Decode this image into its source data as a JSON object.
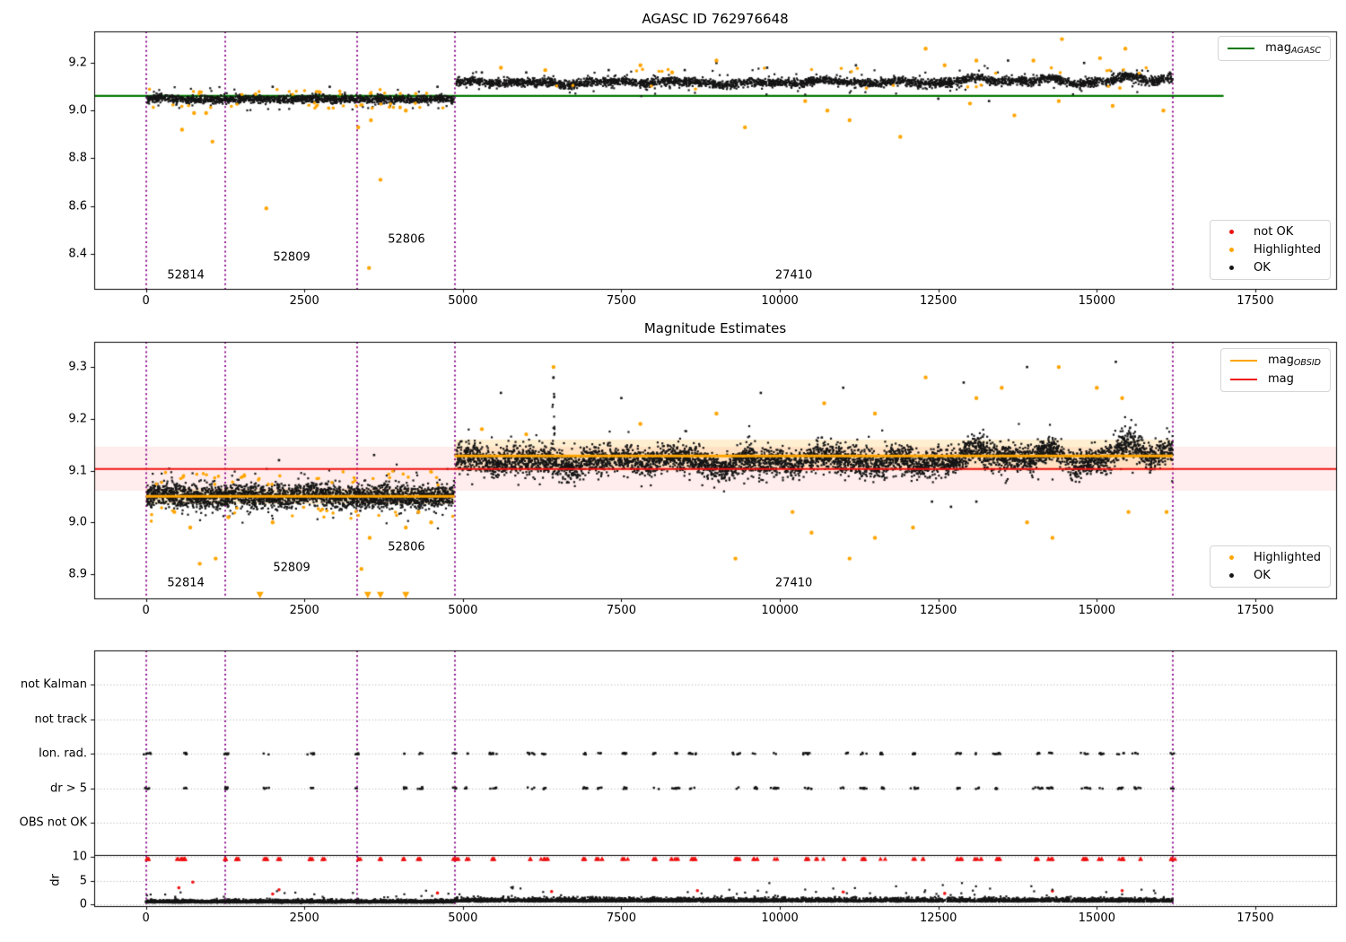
{
  "figure": {
    "title_top": "AGASC ID 762976648",
    "title_mid": "Magnitude Estimates"
  },
  "colors": {
    "green": "#007800",
    "red": "#ee1111",
    "orange": "#ffa500",
    "purple": "#880088",
    "black": "#151515",
    "band_pink": "rgba(255,40,40,0.09)",
    "band_orange": "rgba(255,165,0,0.18)",
    "grid": "#aaaaaa"
  },
  "legends": {
    "top_line": {
      "main": "mag",
      "sub": "AGASC",
      "color": "#007800"
    },
    "top_markers": [
      {
        "label": "not OK",
        "color": "#ee1111"
      },
      {
        "label": "Highlighted",
        "color": "#ffa500"
      },
      {
        "label": "OK",
        "color": "#151515"
      }
    ],
    "mid_lines": [
      {
        "main": "mag",
        "sub": "OBSID",
        "color": "#ffa500"
      },
      {
        "main": "mag",
        "sub": "",
        "color": "#ee1111"
      }
    ],
    "mid_markers": [
      {
        "label": "Highlighted",
        "color": "#ffa500"
      },
      {
        "label": "OK",
        "color": "#151515"
      }
    ]
  },
  "chart_data": [
    {
      "id": "agasc-mag-plot",
      "type": "scatter",
      "title": "AGASC ID 762976648",
      "xlim": [
        -815,
        18775
      ],
      "ylim": [
        8.25,
        9.33
      ],
      "xticks": [
        "0",
        "2500",
        "5000",
        "7500",
        "10000",
        "12500",
        "15000",
        "17500"
      ],
      "xtick_values": [
        0,
        2500,
        5000,
        7500,
        10000,
        12500,
        15000,
        17500
      ],
      "yticks": [
        "8.4",
        "8.6",
        "8.8",
        "9.0",
        "9.2"
      ],
      "ytick_values": [
        8.4,
        8.6,
        8.8,
        9.0,
        9.2
      ],
      "mag_agasc_line": {
        "y": 9.062,
        "x0": -815,
        "x1": 17000
      },
      "obsid_boundaries": [
        0,
        1250,
        3330,
        4870,
        16200
      ],
      "obsid_labels": [
        {
          "text": "52814",
          "x": 630,
          "y": 8.31
        },
        {
          "text": "52809",
          "x": 2300,
          "y": 8.385
        },
        {
          "text": "52806",
          "x": 4110,
          "y": 8.46
        },
        {
          "text": "27410",
          "x": 10220,
          "y": 8.31
        }
      ],
      "series_ok_segments": [
        {
          "x0": 20,
          "x1": 4860,
          "n": 1500,
          "mean": 9.048,
          "sd": 0.008,
          "wobble": 0.003,
          "trend": 0
        },
        {
          "x0": 4890,
          "x1": 16200,
          "n": 3300,
          "mean": 9.118,
          "sd": 0.009,
          "wobble": 0.01,
          "trend": 0.013
        }
      ],
      "highlighted_points": [
        [
          570,
          8.92
        ],
        [
          760,
          8.99
        ],
        [
          950,
          8.99
        ],
        [
          1050,
          8.87
        ],
        [
          1900,
          8.59
        ],
        [
          3350,
          8.93
        ],
        [
          3520,
          8.34
        ],
        [
          3550,
          8.96
        ],
        [
          3700,
          8.71
        ],
        [
          4100,
          9.0
        ],
        [
          9450,
          8.93
        ],
        [
          10400,
          9.04
        ],
        [
          10750,
          9.0
        ],
        [
          11100,
          8.96
        ],
        [
          11900,
          8.89
        ],
        [
          13000,
          9.03
        ],
        [
          13700,
          8.98
        ],
        [
          14400,
          9.04
        ],
        [
          15250,
          9.02
        ],
        [
          16050,
          9.0
        ],
        [
          12300,
          9.26
        ],
        [
          13100,
          9.21
        ],
        [
          14450,
          9.3
        ],
        [
          15450,
          9.26
        ],
        [
          12600,
          9.19
        ],
        [
          14000,
          9.21
        ],
        [
          15050,
          9.22
        ],
        [
          5600,
          9.18
        ],
        [
          7800,
          9.19
        ],
        [
          9000,
          9.21
        ],
        [
          6300,
          9.17
        ],
        [
          8300,
          9.16
        ]
      ],
      "black_outliers": [
        [
          2000,
          9.1
        ],
        [
          2900,
          9.1
        ],
        [
          4600,
          9.1
        ],
        [
          5300,
          9.16
        ],
        [
          6000,
          9.16
        ],
        [
          7300,
          9.17
        ],
        [
          8500,
          9.17
        ],
        [
          9000,
          9.2
        ],
        [
          9800,
          9.18
        ],
        [
          11200,
          9.19
        ],
        [
          13600,
          9.21
        ],
        [
          14800,
          9.2
        ],
        [
          12500,
          9.05
        ],
        [
          13300,
          9.04
        ]
      ]
    },
    {
      "id": "magnitude-estimates-plot",
      "type": "scatter",
      "title": "Magnitude Estimates",
      "xlim": [
        -815,
        18775
      ],
      "ylim": [
        8.855,
        9.35
      ],
      "xticks": [
        "0",
        "2500",
        "5000",
        "7500",
        "10000",
        "12500",
        "15000",
        "17500"
      ],
      "xtick_values": [
        0,
        2500,
        5000,
        7500,
        10000,
        12500,
        15000,
        17500
      ],
      "yticks": [
        "8.9",
        "9.0",
        "9.1",
        "9.2",
        "9.3"
      ],
      "ytick_values": [
        8.9,
        9.0,
        9.1,
        9.2,
        9.3
      ],
      "mag_line": {
        "y": 9.103
      },
      "mag_err_band": [
        9.061,
        9.146
      ],
      "obsid_mag_segments": [
        {
          "x0": 0,
          "x1": 4870,
          "mag": 9.05,
          "band": [
            9.035,
            9.065
          ]
        },
        {
          "x0": 4870,
          "x1": 16200,
          "mag": 9.128,
          "band": [
            9.1,
            9.16
          ]
        }
      ],
      "obsid_boundaries": [
        0,
        1250,
        3330,
        4870,
        16200
      ],
      "obsid_labels": [
        {
          "text": "52814",
          "x": 630,
          "y": 8.8825
        },
        {
          "text": "52809",
          "x": 2300,
          "y": 8.912
        },
        {
          "text": "52806",
          "x": 4110,
          "y": 8.952
        },
        {
          "text": "27410",
          "x": 10220,
          "y": 8.8825
        }
      ],
      "series_ok_segments": [
        {
          "x0": 20,
          "x1": 4860,
          "n": 2600,
          "mean": 9.05,
          "sd": 0.011,
          "wobble": 0.004,
          "trend": 0
        },
        {
          "x0": 4890,
          "x1": 16200,
          "n": 5200,
          "mean": 9.118,
          "sd": 0.013,
          "wobble": 0.013,
          "trend": 0.016
        }
      ],
      "black_streak": {
        "x": 6430,
        "y0": 9.14,
        "y1": 9.28,
        "n": 16
      },
      "clipped_low_triangles_x": [
        1800,
        3500,
        3700,
        4100
      ],
      "highlighted_points": [
        [
          450,
          9.02
        ],
        [
          700,
          8.99
        ],
        [
          850,
          8.92
        ],
        [
          1100,
          8.93
        ],
        [
          1300,
          9.01
        ],
        [
          2000,
          9.0
        ],
        [
          3400,
          8.91
        ],
        [
          3530,
          8.97
        ],
        [
          4100,
          8.99
        ],
        [
          4300,
          9.02
        ],
        [
          4500,
          9.0
        ],
        [
          9300,
          8.93
        ],
        [
          10200,
          9.02
        ],
        [
          10500,
          8.98
        ],
        [
          11100,
          8.93
        ],
        [
          11500,
          8.97
        ],
        [
          12100,
          8.99
        ],
        [
          13900,
          9.0
        ],
        [
          14300,
          8.97
        ],
        [
          15500,
          9.02
        ],
        [
          16100,
          9.02
        ],
        [
          6000,
          9.17
        ],
        [
          7800,
          9.19
        ],
        [
          9000,
          9.21
        ],
        [
          10700,
          9.23
        ],
        [
          11500,
          9.21
        ],
        [
          12300,
          9.28
        ],
        [
          13100,
          9.24
        ],
        [
          13500,
          9.26
        ],
        [
          14400,
          9.3
        ],
        [
          15000,
          9.26
        ],
        [
          15400,
          9.24
        ],
        [
          5300,
          9.18
        ],
        [
          6430,
          9.3
        ]
      ],
      "black_outliers": [
        [
          2100,
          9.12
        ],
        [
          3600,
          9.13
        ],
        [
          5600,
          9.25
        ],
        [
          6430,
          9.28
        ],
        [
          7500,
          9.24
        ],
        [
          9700,
          9.25
        ],
        [
          11000,
          9.26
        ],
        [
          12400,
          9.04
        ],
        [
          12700,
          9.03
        ],
        [
          13100,
          9.04
        ],
        [
          13900,
          9.3
        ],
        [
          15300,
          9.31
        ],
        [
          12900,
          9.27
        ]
      ]
    },
    {
      "id": "flags-dr-plot",
      "type": "scatter-flags",
      "categories": [
        "not Kalman",
        "not track",
        "Ion. rad.",
        "dr > 5",
        "OBS not OK"
      ],
      "ylabel": "dr",
      "dr_ticks": [
        "10",
        "5",
        "0"
      ],
      "dr_tick_values": [
        10,
        5,
        0
      ],
      "xticks": [
        "0",
        "2500",
        "5000",
        "7500",
        "10000",
        "12500",
        "15000",
        "17500"
      ],
      "xtick_values": [
        0,
        2500,
        5000,
        7500,
        10000,
        12500,
        15000,
        17500
      ],
      "obsid_boundaries": [
        0,
        1250,
        3330,
        4870,
        16200
      ],
      "event_clusters_x": [
        30,
        620,
        1270,
        1900,
        2600,
        3350,
        4080,
        4320,
        4870,
        5080,
        5480,
        6080,
        6280,
        6930,
        7160,
        7560,
        8020,
        8360,
        8620,
        9320,
        9620,
        9920,
        10420,
        11020,
        11320,
        11620,
        12120,
        12820,
        13120,
        13420,
        14070,
        14270,
        14820,
        15070,
        15370,
        15620,
        16200
      ],
      "red_clusters_x": [
        30,
        550,
        620,
        1270,
        1450,
        1900,
        2100,
        2600,
        2800,
        3350,
        3700,
        4080,
        4320,
        4870,
        5080,
        5480,
        6080,
        6280,
        6930,
        7160,
        7560,
        8020,
        8360,
        8620,
        9320,
        9620,
        9920,
        10420,
        10620,
        11020,
        11320,
        11620,
        12120,
        12320,
        12820,
        13120,
        13420,
        14070,
        14270,
        14820,
        15070,
        15370,
        15620,
        16200
      ],
      "red_dr_points": [
        [
          520,
          3.5
        ],
        [
          740,
          4.7
        ],
        [
          2000,
          2.2
        ],
        [
          2100,
          3.1
        ],
        [
          4600,
          2.4
        ],
        [
          6400,
          2.7
        ],
        [
          8700,
          2.9
        ],
        [
          11000,
          2.6
        ],
        [
          12600,
          2.3
        ],
        [
          14300,
          2.8
        ],
        [
          15400,
          2.9
        ]
      ],
      "dr_band_segments": [
        {
          "x0": 0,
          "x1": 4860,
          "n": 2800,
          "base": 0.35,
          "spread": 0.45
        },
        {
          "x0": 4870,
          "x1": 16200,
          "n": 3800,
          "base": 0.55,
          "spread": 0.65
        }
      ],
      "dr_limit_value": 10
    }
  ]
}
